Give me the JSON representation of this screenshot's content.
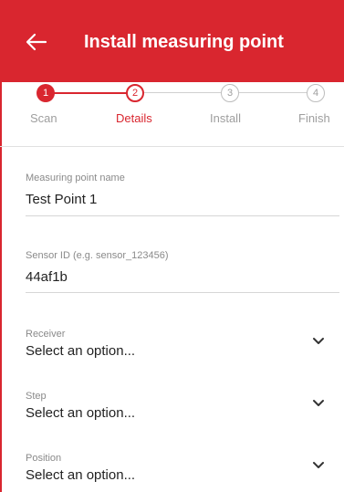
{
  "header": {
    "title": "Install measuring point"
  },
  "stepper": {
    "steps": [
      {
        "number": "1",
        "label": "Scan",
        "state": "done"
      },
      {
        "number": "2",
        "label": "Details",
        "state": "active"
      },
      {
        "number": "3",
        "label": "Install",
        "state": "todo"
      },
      {
        "number": "4",
        "label": "Finish",
        "state": "todo"
      }
    ]
  },
  "form": {
    "name_field": {
      "label": "Measuring point name",
      "value": "Test Point 1"
    },
    "sensor_field": {
      "label": "Sensor ID (e.g. sensor_123456)",
      "value": "44af1b"
    },
    "receiver_select": {
      "label": "Receiver",
      "value": "Select an option..."
    },
    "step_select": {
      "label": "Step",
      "value": "Select an option..."
    },
    "position_select": {
      "label": "Position",
      "value": "Select an option..."
    }
  },
  "colors": {
    "accent": "#d9262f",
    "inactive": "#9e9e9e"
  },
  "icons": {
    "back": "arrow-left-icon",
    "dropdown": "chevron-down-icon"
  }
}
